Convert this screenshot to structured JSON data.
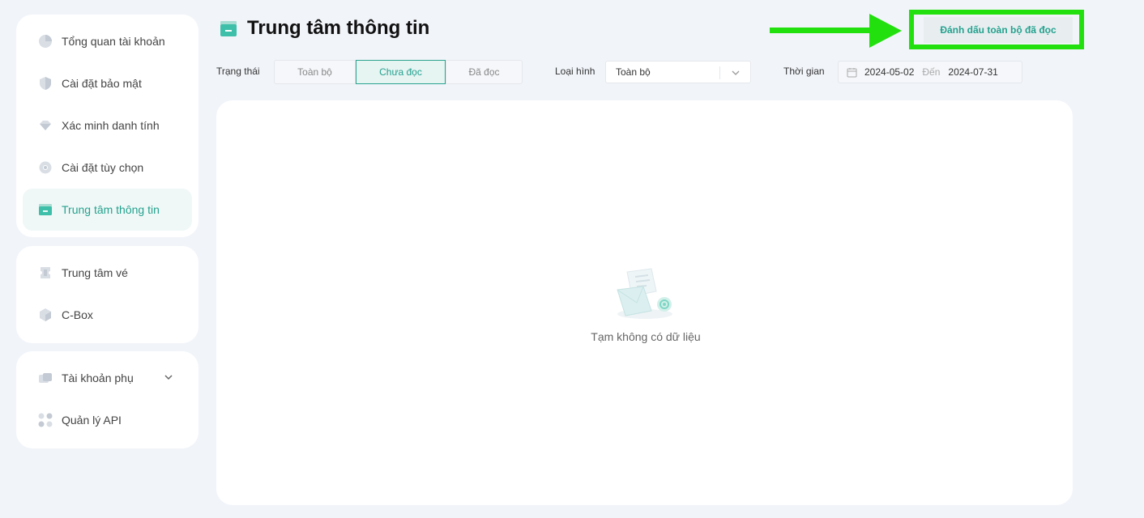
{
  "sidebar": {
    "group1": [
      {
        "label": "Tổng quan tài khoản",
        "icon": "pie-chart-icon"
      },
      {
        "label": "Cài đặt bảo mật",
        "icon": "shield-icon"
      },
      {
        "label": "Xác minh danh tính",
        "icon": "diamond-icon"
      },
      {
        "label": "Cài đặt tùy chọn",
        "icon": "gear-icon"
      },
      {
        "label": "Trung tâm thông tin",
        "icon": "message-box-icon",
        "active": true
      }
    ],
    "group2": [
      {
        "label": "Trung tâm vé",
        "icon": "ticket-icon"
      },
      {
        "label": "C-Box",
        "icon": "box-icon"
      }
    ],
    "group3": [
      {
        "label": "Tài khoản phụ",
        "icon": "sub-account-icon",
        "expandable": true
      },
      {
        "label": "Quản lý API",
        "icon": "api-icon"
      }
    ]
  },
  "header": {
    "title": "Trung tâm thông tin",
    "mark_all_read": "Đánh dấu toàn bộ đã đọc",
    "highlight_color": "#22e00d"
  },
  "filters": {
    "status_label": "Trạng thái",
    "status_options": [
      "Toàn bộ",
      "Chưa đọc",
      "Đã đọc"
    ],
    "status_selected": "Chưa đọc",
    "type_label": "Loại hình",
    "type_value": "Toàn bộ",
    "time_label": "Thời gian",
    "date_start": "2024-05-02",
    "date_separator": "Đến",
    "date_end": "2024-07-31"
  },
  "content": {
    "empty_text": "Tạm không có dữ liệu"
  },
  "colors": {
    "accent": "#24a18e",
    "background": "#f1f4f9"
  }
}
